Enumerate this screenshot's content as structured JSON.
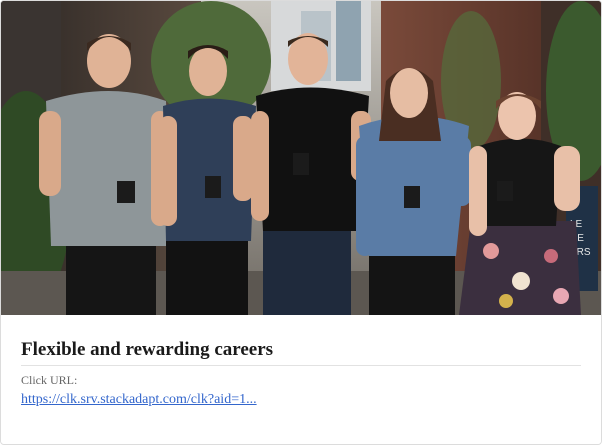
{
  "ad": {
    "title": "Flexible and rewarding careers",
    "url_label": "Click URL:",
    "url_text": "https://clk.srv.stackadapt.com/clk?aid=1...",
    "image_alt": "Five smiling colleagues standing in a laneway holding coffee cups",
    "sign_text": "LE\nRE\nERS"
  },
  "colors": {
    "title": "#1a1a1a",
    "link": "#3366cc",
    "label": "#666666"
  }
}
